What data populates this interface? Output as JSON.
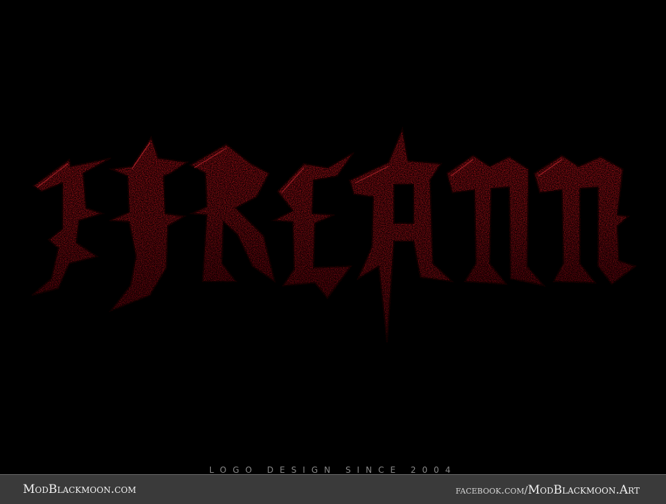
{
  "logo": {
    "text": "IFREANN",
    "color": "#c4121a",
    "shadow_color": "#4a0205"
  },
  "tagline": {
    "text": "LOGO  DESIGN  SINCE  2004"
  },
  "footer": {
    "site": "ModBlackmoon.com",
    "social_prefix": "facebook.com/",
    "social_handle": "ModBlackmoon.Art"
  },
  "colors": {
    "background": "#000000",
    "footer_bar": "#3a3a3a",
    "footer_text": "#f2f2f2",
    "tagline_text": "#8a8a8a"
  }
}
